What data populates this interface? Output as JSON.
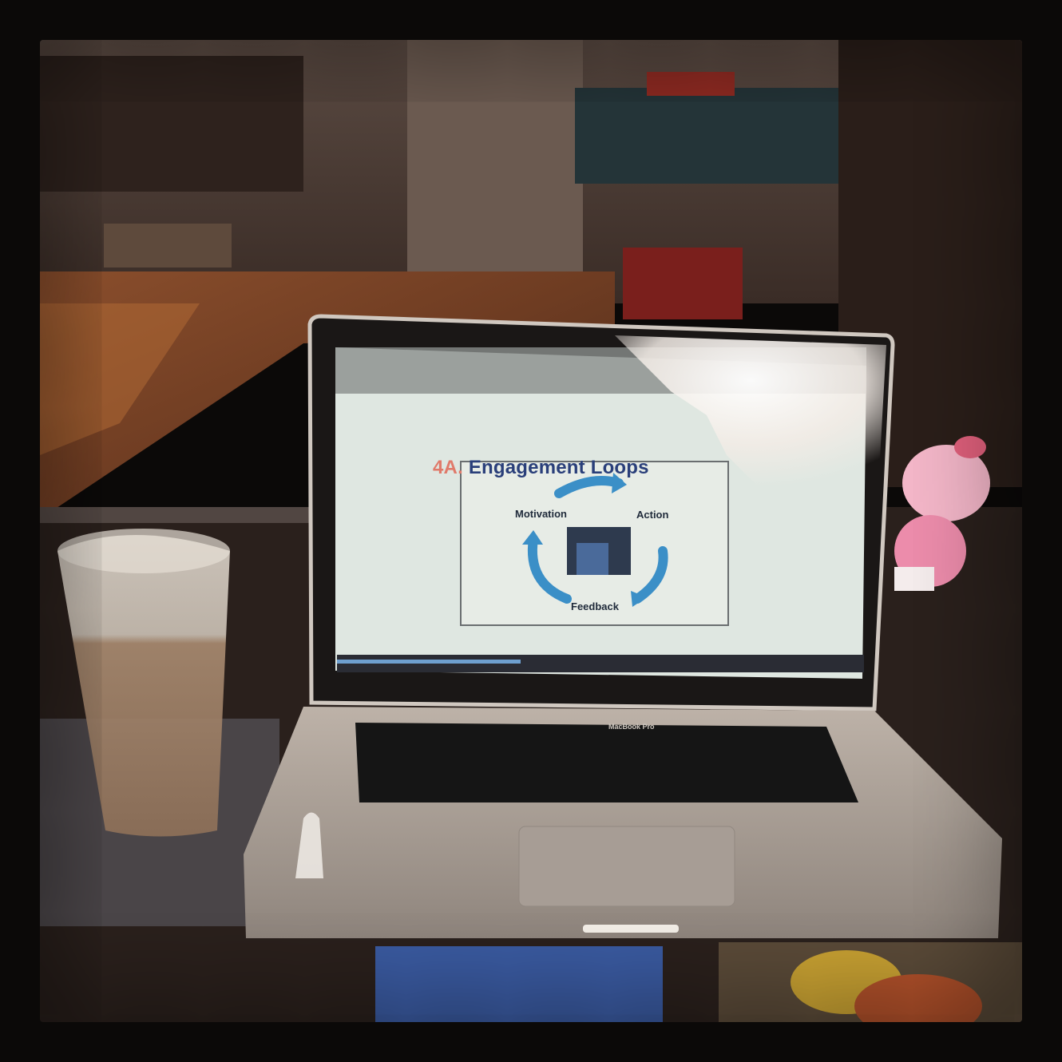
{
  "slide": {
    "title_number": "4A.",
    "title_text": " Engagement Loops",
    "labels": {
      "motivation": "Motivation",
      "action": "Action",
      "feedback": "Feedback"
    }
  },
  "laptop": {
    "brand": "MacBook Pro"
  },
  "colors": {
    "slide_title": "#2a3f7a",
    "slide_number": "#e07a6a",
    "loop_arrows": "#3b8fc7",
    "screen_bg": "#dfe7e1"
  }
}
